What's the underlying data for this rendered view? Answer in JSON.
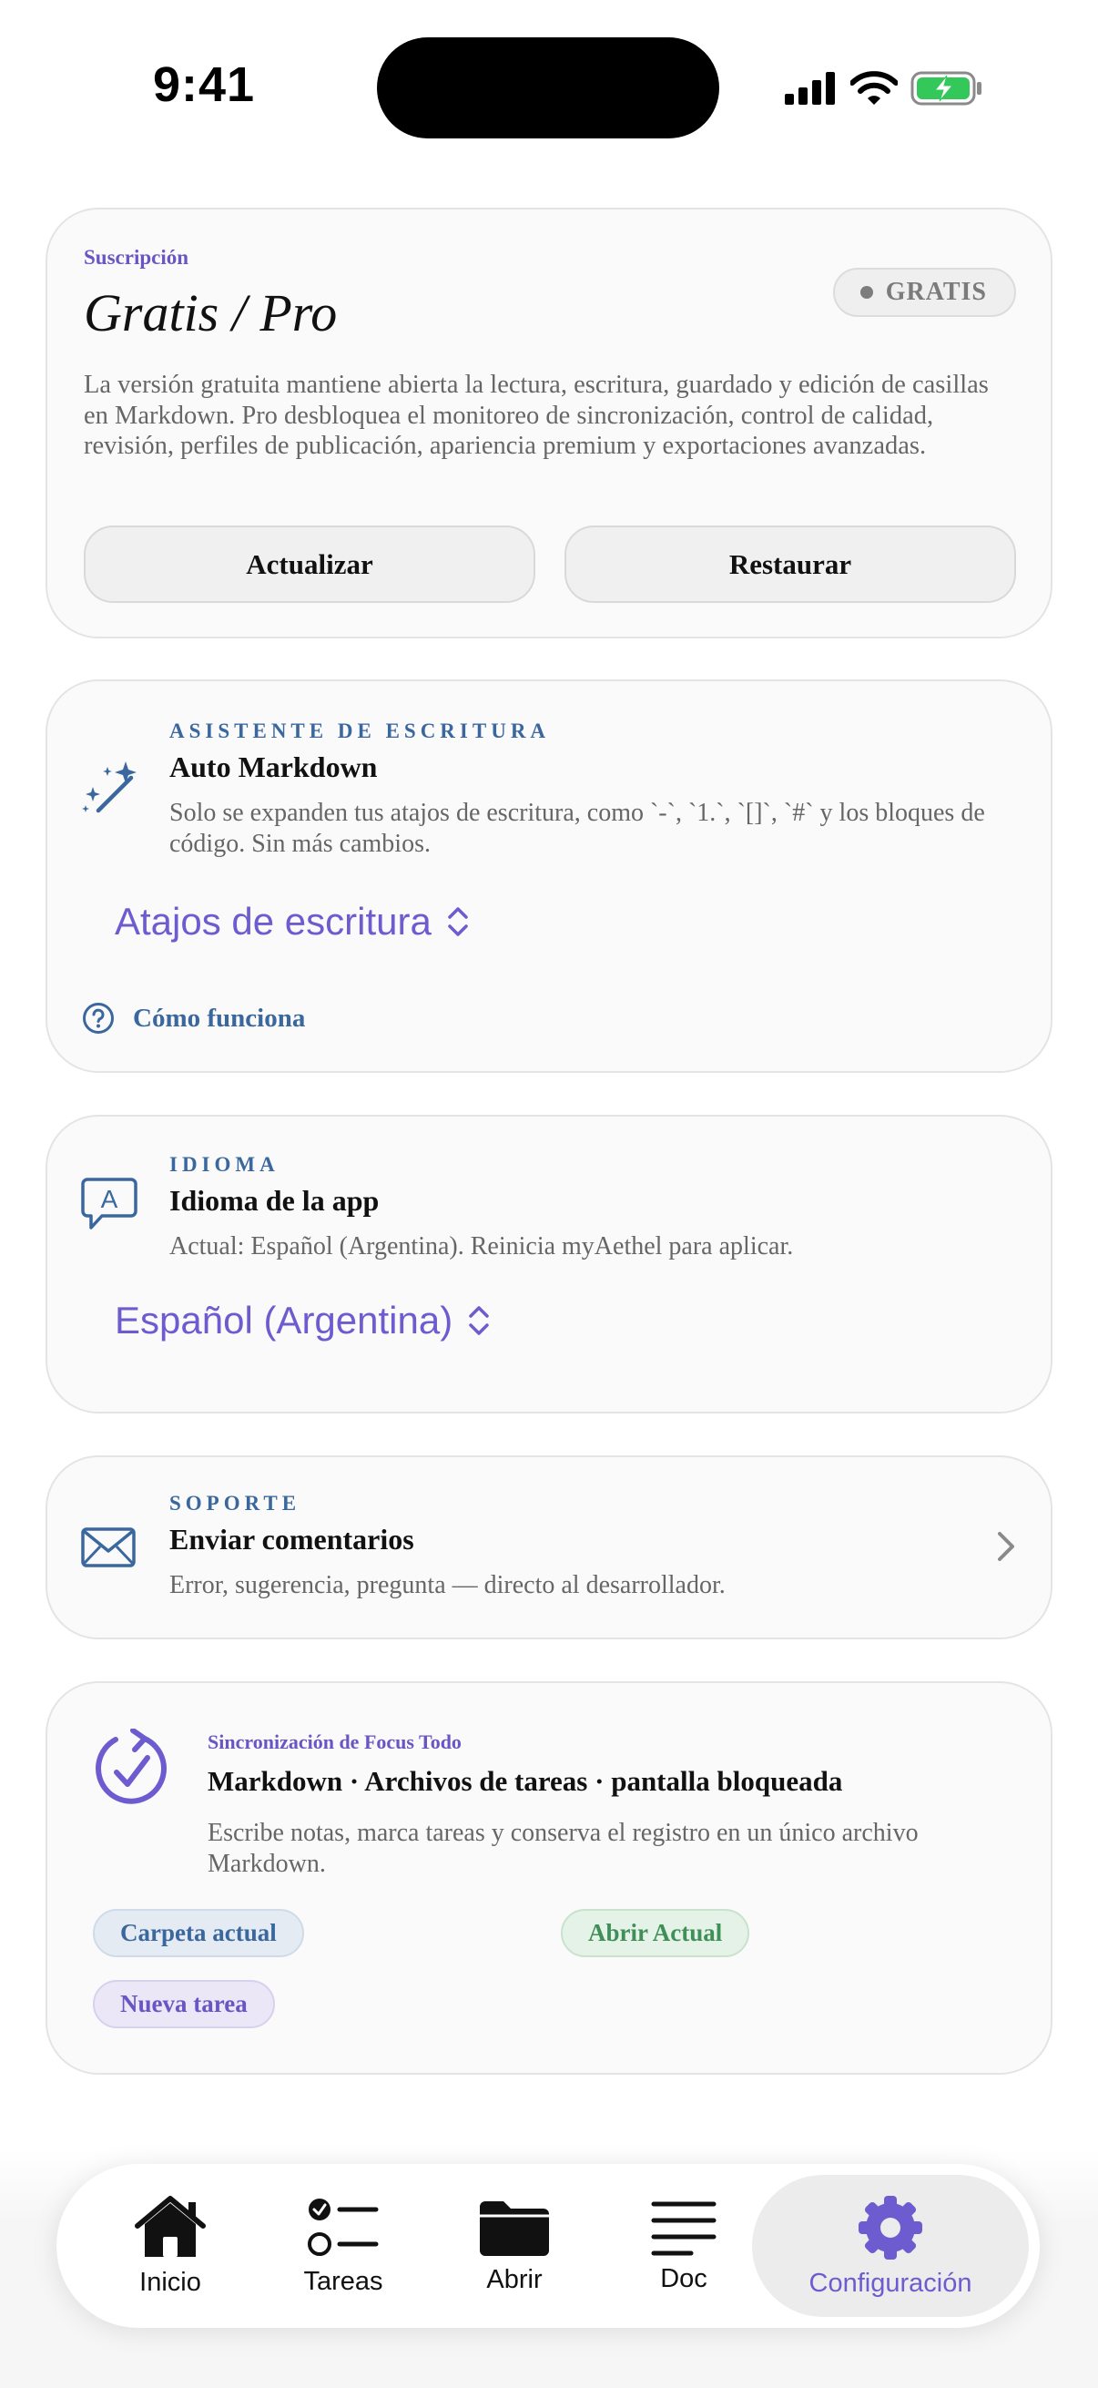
{
  "status_bar": {
    "time": "9:41"
  },
  "subscription": {
    "overline": "Suscripción",
    "title": "Gratis / Pro",
    "badge": "GRATIS",
    "description": "La versión gratuita mantiene abierta la lectura, escritura, guardado y edición de casillas en Markdown. Pro desbloquea el monitoreo de sincronización, control de calidad, revisión, perfiles de publicación, apariencia premium y exportaciones avanzadas.",
    "upgrade_label": "Actualizar",
    "restore_label": "Restaurar"
  },
  "writing_assistant": {
    "overline": "ASISTENTE DE ESCRITURA",
    "title": "Auto Markdown",
    "description": "Solo se expanden tus atajos de escritura, como `-`, `1.`, `[]`, `#` y los bloques de código. Sin más cambios.",
    "picker_value": "Atajos de escritura",
    "how_it_works": "Cómo funciona"
  },
  "language": {
    "overline": "IDIOMA",
    "title": "Idioma de la app",
    "description": "Actual: Español (Argentina). Reinicia myAethel para aplicar.",
    "picker_value": "Español (Argentina)"
  },
  "support": {
    "overline": "SOPORTE",
    "title": "Enviar comentarios",
    "description": "Error, sugerencia, pregunta — directo al desarrollador."
  },
  "sync": {
    "overline": "Sincronización de Focus Todo",
    "title": "Markdown · Archivos de tareas · pantalla bloqueada",
    "description": "Escribe notas, marca tareas y conserva el registro en un único archivo Markdown.",
    "chips": [
      "Carpeta actual",
      "Abrir Actual",
      "Nueva tarea"
    ]
  },
  "tab_bar": {
    "items": [
      {
        "label": "Inicio",
        "icon": "house-icon"
      },
      {
        "label": "Tareas",
        "icon": "checklist-icon"
      },
      {
        "label": "Abrir",
        "icon": "folder-icon"
      },
      {
        "label": "Doc",
        "icon": "lines-icon"
      },
      {
        "label": "Configuración",
        "icon": "gear-icon",
        "selected": true
      }
    ]
  },
  "colors": {
    "accent_purple": "#6d5ccf",
    "accent_blue": "#3a679d",
    "accent_green": "#3f8f58",
    "battery_green": "#34c759"
  }
}
